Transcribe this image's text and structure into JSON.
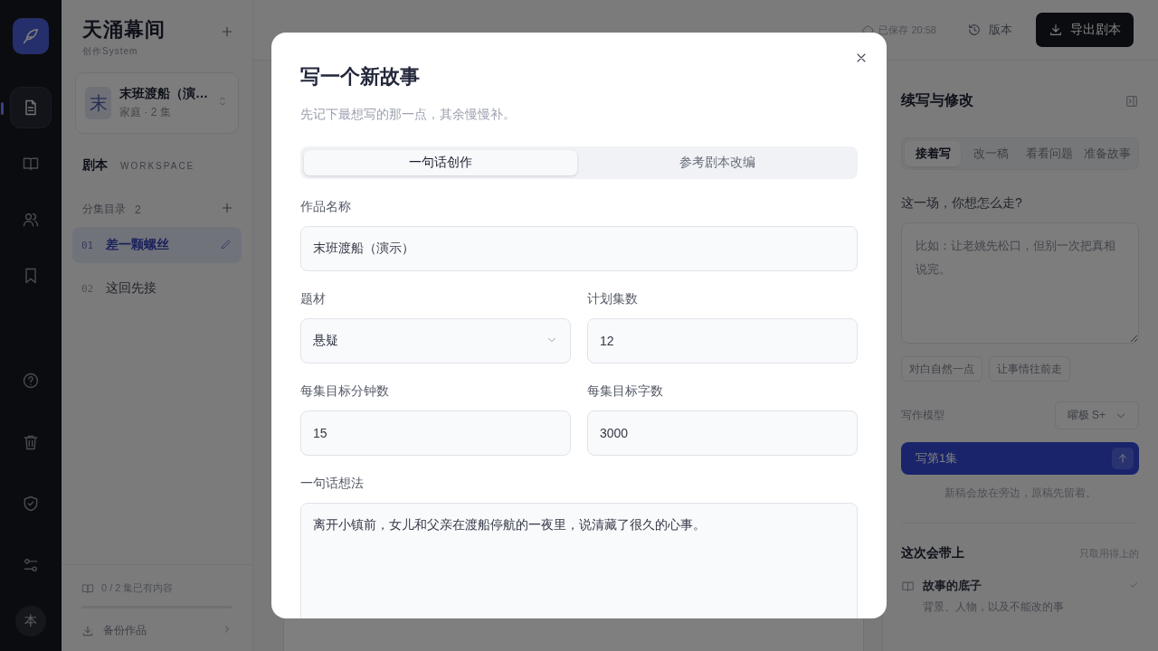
{
  "rail": {
    "items": [
      {
        "selected": true
      },
      {
        "selected": false
      },
      {
        "selected": false
      },
      {
        "selected": false
      }
    ],
    "avatar": "本"
  },
  "sidebar": {
    "title": "天涌幕间",
    "subtitle": "创作System",
    "project": {
      "initial": "末",
      "name": "末班渡船（演…",
      "meta": "家庭 · 2 集"
    },
    "section": {
      "label": "剧本",
      "tag": "WORKSPACE"
    },
    "episodes_header": {
      "label": "分集目录",
      "count": "2"
    },
    "episodes": [
      {
        "number": "01",
        "title": "差一颗螺丝",
        "selected": true
      },
      {
        "number": "02",
        "title": "这回先接",
        "selected": false
      }
    ],
    "progress": "0 / 2 集已有内容",
    "backup": "备份作品"
  },
  "topbar": {
    "saved": "已保存 20:58",
    "versions": "版本",
    "export": "导出剧本"
  },
  "assistant": {
    "title": "续写与修改",
    "tabs": [
      {
        "label": "接着写",
        "selected": true
      },
      {
        "label": "改一稿",
        "selected": false
      },
      {
        "label": "看看问题",
        "selected": false
      },
      {
        "label": "准备故事",
        "selected": false
      }
    ],
    "prompt_label": "这一场，你想怎么走?",
    "placeholder": "比如：让老姚先松口，但别一次把真相说完。",
    "chips": [
      "对白自然一点",
      "让事情往前走"
    ],
    "model_label": "写作模型",
    "model": "曜极 S+",
    "write": "写第1集",
    "note": "新稿会放在旁边，原稿先留着。",
    "context_title": "这次会带上",
    "context_hint": "只取用得上的",
    "context_items": [
      {
        "title": "故事的底子",
        "description": "背景、人物，以及不能改的事",
        "checked": true
      }
    ]
  },
  "modal": {
    "title": "写一个新故事",
    "subtitle": "先记下最想写的那一点，其余慢慢补。",
    "modes": [
      {
        "label": "一句话创作",
        "selected": true
      },
      {
        "label": "参考剧本改编",
        "selected": false
      }
    ],
    "rows": [
      [
        {
          "kind": "text",
          "label": "作品名称",
          "value": "末班渡船（演示）"
        }
      ],
      [
        {
          "kind": "select",
          "label": "题材",
          "value": "悬疑"
        },
        {
          "kind": "text",
          "label": "计划集数",
          "value": "12"
        }
      ],
      [
        {
          "kind": "text",
          "label": "每集目标分钟数",
          "value": "15"
        },
        {
          "kind": "text",
          "label": "每集目标字数",
          "value": "3000"
        }
      ],
      [
        {
          "kind": "textarea",
          "label": "一句话想法",
          "value": "离开小镇前，女儿和父亲在渡船停航的一夜里，说清藏了很久的心事。"
        }
      ]
    ]
  }
}
